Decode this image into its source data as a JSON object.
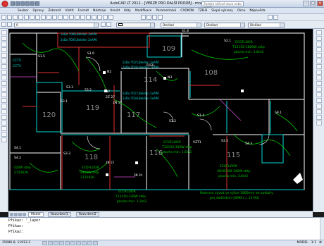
{
  "window": {
    "title": "AutoCAD LT 2012 - [VERZE PRO DALŠÍ PRODEJ - mnm.dwg]",
    "search_placeholder": "Zadejte klíčové slovo nebo výraz"
  },
  "menubar": {
    "items": [
      "Soubor",
      "Úpravy",
      "Zobrazit",
      "Vložit",
      "Formát",
      "Nástroje",
      "Kreslit",
      "Kóty",
      "Modifikace",
      "Parametrické",
      "CADKON",
      "TZB-B",
      "Slepé výkresy",
      "Okno",
      "Nápověda"
    ]
  },
  "toolbar": {
    "layer_combo": "0",
    "linetype_combo": "DleHlad",
    "lineweight_combo": "DleHlad",
    "plotstyle_combo": "DleHlad"
  },
  "drawing": {
    "rooms": [
      "108",
      "109",
      "114",
      "117",
      "119",
      "120",
      "116",
      "118",
      "115"
    ],
    "labels": {
      "s1_5a": "S1.5",
      "s1_6": "S1.6",
      "s1_8": "S1.8",
      "s3_3a": "S3.3",
      "s3_3b": "S3.3",
      "s3_2": "S3.2",
      "s3_1": "S3.1",
      "s4_1": "S4.1",
      "s4_2": "S4.2",
      "n2a": "N2",
      "n2b": "N2",
      "n3": "N3",
      "n2_17": "2N 17",
      "z2_27": "2Z 27",
      "s9_1": "S9.1",
      "s2_1": "S2.1",
      "s1_2": "S1.2",
      "s1_4": "S1.4",
      "s3_5": "S3.5",
      "v3_1": "VZT1",
      "s4_3": "S4.3",
      "cctv1": "CCTV",
      "cctv2": "CCTV",
      "dat1": "2xDo T006,Bekllen 2xAP6",
      "dat2": "2xDo T005,Bekllen 2xAP6",
      "dat3": "2xDo T015,Bekllen 2xAP6",
      "dat4": "2xDo T016,Bekllen 2xAP6",
      "dat5": "2xDo T017,Bekllen 2xAP6",
      "dat6": "2xDo T018,Bekllen 2xAP6",
      "eco1_title": "ECOFLOOR",
      "eco1_a": "T12150-1800W stěp",
      "eco1_b": "plocha min. 1.8m2",
      "eco2_title": "ECOFLOOR",
      "eco2_a": "T12150-350W stěp",
      "eco2_b": "plocha min. 1,6m2",
      "eco3_title": "ECOFLOOR",
      "eco3_a": "ADH5340-340W stěp",
      "eco3_b": "plocha min. 3,6m2",
      "eco4_title": "ECOFLOOR",
      "eco4_a": "T12150-330W stěp",
      "eco4_b": "plocha min. 1,3m2",
      "eco5_a": "-320W stěp",
      "eco5_b": "2722626",
      "eco6_title": "ECOFLOOR",
      "eco6_a": "-1800W stěp",
      "eco6_b": "2722626",
      "note1": "Rezervní vývod ve výšce 1800mm od podlahy",
      "note2": "pro dadlinkim (SIMEI) = 13-9UJ",
      "k1": "R1ELL",
      "k2": "2N 15",
      "k3": "2N 10"
    }
  },
  "tabs": {
    "model": "Model",
    "layout1": "Rozvržení1",
    "layout2": "Rozvržení2"
  },
  "command": {
    "line1": "Příkaz: '_layer",
    "line2": "Příkaz:",
    "line3": "Příkaz:"
  },
  "status": {
    "coords": "25086.8, 11913.2",
    "model_label": "MODEL",
    "scale": "1:1"
  },
  "colors": {
    "background": "#000000",
    "walls": "#ffffff",
    "cyan": "#00d8d8",
    "green": "#00c800",
    "red": "#e23131",
    "magenta": "#d24ad2"
  }
}
